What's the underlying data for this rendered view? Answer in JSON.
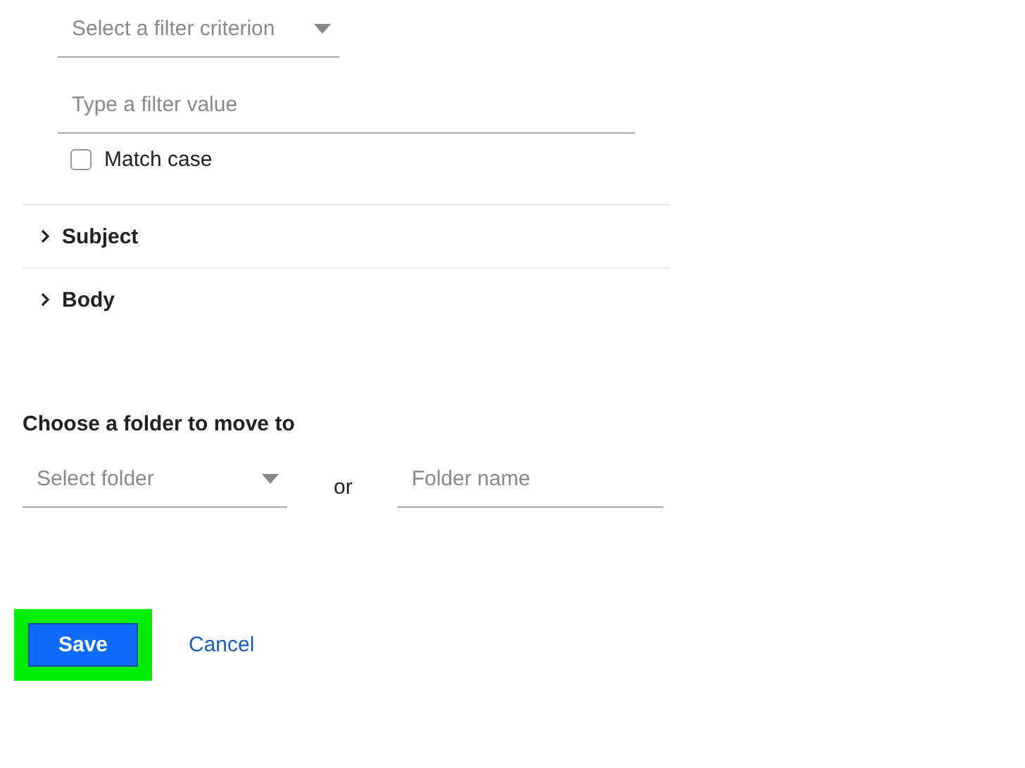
{
  "filter": {
    "criterion": {
      "placeholder": "Select a filter criterion"
    },
    "value": {
      "placeholder": "Type a filter value"
    },
    "match_case": {
      "label": "Match case",
      "checked": false
    }
  },
  "sections": [
    {
      "label": "Subject",
      "expanded": false
    },
    {
      "label": "Body",
      "expanded": false
    }
  ],
  "folder": {
    "heading": "Choose a folder to move to",
    "select": {
      "placeholder": "Select folder"
    },
    "separator": "or",
    "name": {
      "placeholder": "Folder name"
    }
  },
  "buttons": {
    "save": {
      "label": "Save",
      "highlighted": true
    },
    "cancel": {
      "label": "Cancel"
    }
  }
}
